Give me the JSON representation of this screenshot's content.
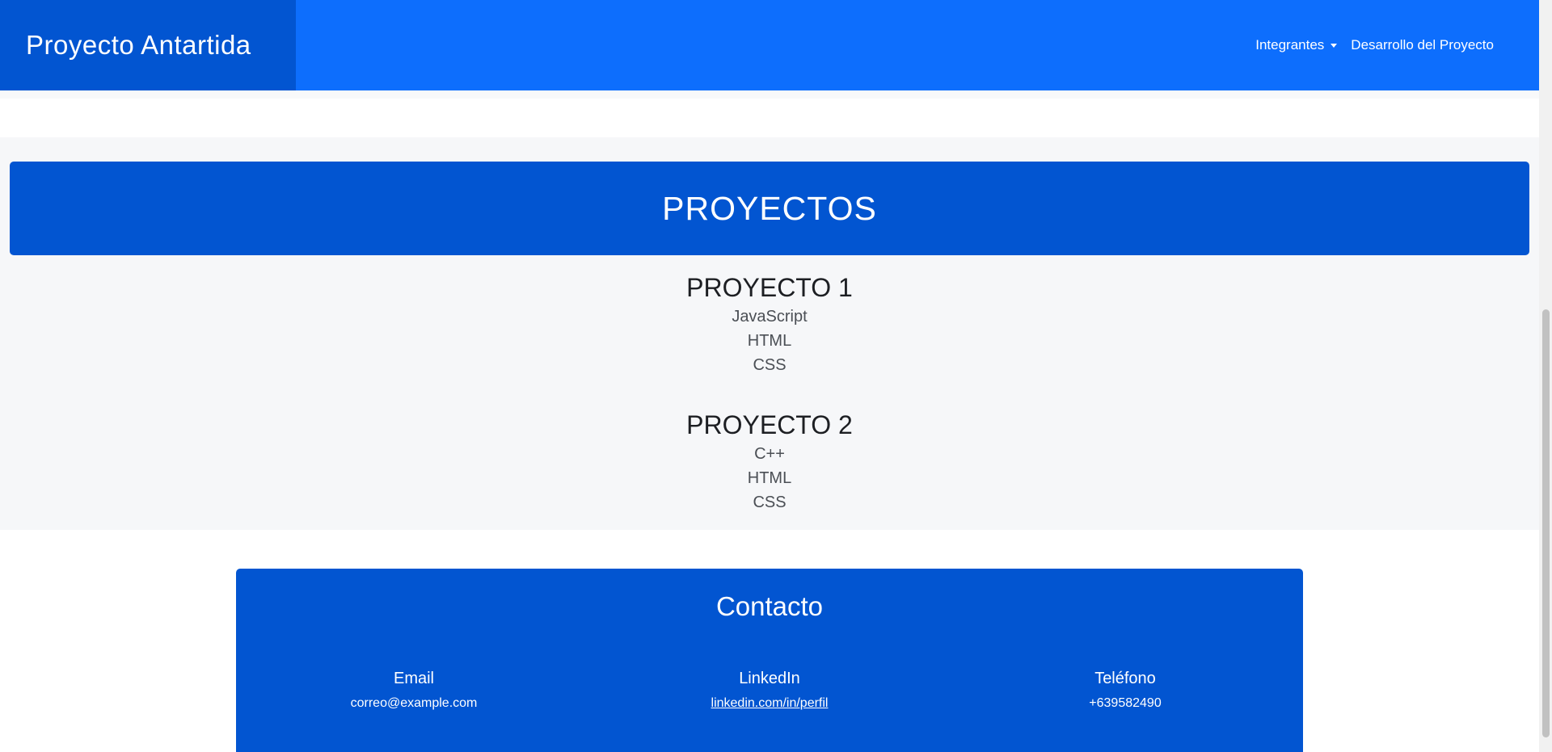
{
  "navbar": {
    "brand": "Proyecto Antartida",
    "links": [
      {
        "label": "Integrantes",
        "dropdown": true
      },
      {
        "label": "Desarrollo del Proyecto",
        "dropdown": false
      }
    ]
  },
  "projects": {
    "heading": "PROYECTOS",
    "items": [
      {
        "title": "PROYECTO 1",
        "technologies": [
          "JavaScript",
          "HTML",
          "CSS"
        ]
      },
      {
        "title": "PROYECTO 2",
        "technologies": [
          "C++",
          "HTML",
          "CSS"
        ]
      }
    ]
  },
  "contact": {
    "title": "Contacto",
    "email": {
      "label": "Email",
      "value": "correo@example.com"
    },
    "linkedin": {
      "label": "LinkedIn",
      "value": "linkedin.com/in/perfil"
    },
    "phone": {
      "label": "Teléfono",
      "value": "+639582490"
    }
  },
  "colors": {
    "navbar": "#0d6efd",
    "brand_box": "#0255d1",
    "banner": "#0255d1",
    "section_bg": "#f6f7f9"
  }
}
